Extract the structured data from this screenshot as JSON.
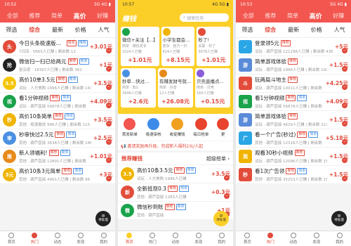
{
  "colors": {
    "accent": "#f2564f",
    "yellow": "#fccf28",
    "price": "#e14a3c"
  },
  "left": {
    "status": {
      "time": "10:52",
      "right": "5G 4G ▮"
    },
    "tabs": [
      "全部",
      "推荐",
      "简单",
      "高价",
      "好赚"
    ],
    "filters": [
      "筛选",
      "综合",
      "最新",
      "价格",
      "人气"
    ],
    "rows": [
      {
        "title": "今日头条极速版填码",
        "tags": [
          "简单",
          "推荐"
        ],
        "meta": "7日回 · 5665人已赚 | 剩余数 12",
        "price": "+3.01元",
        "color": "#e34c3a",
        "icon": "头"
      },
      {
        "title": "微信扫一扫已给两元",
        "tags": [
          "推荐",
          "简单"
        ],
        "meta": "复杂度 · 18397人已赚 | 剩余数 362",
        "price": "+1元",
        "color": "#222",
        "icon": "抢"
      },
      {
        "title": "高价10单3.5元",
        "tags": [
          "推荐",
          "简单"
        ],
        "meta": "试玩 · 人方美购 1996人已赚 | 剩余数 143",
        "price": "+3.5元",
        "color": "#f5c400",
        "icon": "3.5"
      },
      {
        "title": "看1分钟视频",
        "tags": [
          "推荐",
          "简单"
        ],
        "meta": "试玩 · 葫芦直接 56878人已赚 | 剩余数 341",
        "price": "+4.09元",
        "color": "#19a34a",
        "icon": "视"
      },
      {
        "title": "高价10条简单",
        "tags": [
          "推荐",
          "简单"
        ],
        "meta": "其他 · 极速展放 996人已赚 | 剩余数 115",
        "price": "+3.5元",
        "color": "#f0b400",
        "icon": "秒"
      },
      {
        "title": "秒审快过2.5元",
        "tags": [
          "推荐",
          "简单"
        ],
        "meta": "其他 · 葫芦直接 3638人已赚 | 剩余数 186",
        "price": "+2.5元",
        "color": "#4a90e2",
        "icon": "审"
      },
      {
        "title": "新人领福利!",
        "tags": [
          "推荐",
          "简单"
        ],
        "meta": "其他 · 葫芦直接 12891人已赚 | 剩余数 196",
        "price": "+1.01元",
        "color": "#e88a1a",
        "icon": "推"
      },
      {
        "title": "高价10条3元简单",
        "tags": [
          "推荐",
          "简单"
        ],
        "meta": "其他 · 葫芦直接 4991人已赚 | 剩余数 86",
        "price": "+3元",
        "color": "#f0b400",
        "icon": "3元"
      }
    ],
    "nav": [
      "首页",
      "热门",
      "动态",
      "发现",
      "我的"
    ],
    "pending": "待处理"
  },
  "middle": {
    "status": {
      "time": "10:57",
      "right": "4G 5G ▮"
    },
    "logo": "赚钱",
    "search": "搜索任务",
    "cards": [
      {
        "title": "微信+关注【...】",
        "meta": "简单 · 微信发长",
        "count": "1024人已赚",
        "price": "+1.01元"
      },
      {
        "title": "小学生都会...",
        "meta": "复杂 · 官方一日",
        "count": "424人已赚",
        "price": "+8.15元"
      },
      {
        "title": "秒了!",
        "meta": "关联 · 秒了",
        "count": "3976人已赚",
        "price": "+1.01元"
      },
      {
        "title": "秒审...快过...",
        "meta": "简单 · 知1",
        "count": "3946人已赚",
        "price": "+2.6元"
      },
      {
        "title": "有赚发财号就...",
        "meta": "简单 · 抖音",
        "count": "12人已赚",
        "price": "+26.08元"
      },
      {
        "title": "贝壳直播点...",
        "meta": "简单 · 贝壳",
        "count": "165人已赚",
        "price": "+0.15元"
      }
    ],
    "icons": [
      "首发新单",
      "极速审核",
      "收徒赚钱",
      "每日抢单",
      "更"
    ],
    "notice": "📢 邀请奖励再升级，完成新人福利2元/人起",
    "rec": {
      "title": "推荐赚钱",
      "link": "超级榜单 ›"
    },
    "rows": [
      {
        "title": "高价10条3.5元",
        "tags": [
          "推荐",
          "简单"
        ],
        "meta": "试玩 · 人方美购 1996人已赚",
        "price": "+3.5元",
        "color": "#f0b400",
        "icon": "3.5"
      },
      {
        "title": "全新抵现0.3",
        "tags": [
          "推荐",
          "简单"
        ],
        "meta": "其他 · 葫芦直接 1283人已赚",
        "price": "+0.3元",
        "color": "#e34c3a",
        "icon": "新"
      },
      {
        "title": "微信秒到账",
        "tags": [
          "推荐",
          "简单"
        ],
        "meta": "其他 · 葫芦直接",
        "price": "+1元",
        "color": "#19a34a",
        "icon": "微"
      }
    ],
    "nav": [
      "首页",
      "热门",
      "动态",
      "发现",
      "我的"
    ]
  },
  "right": {
    "status": {
      "time": "10:53",
      "right": "5G 4G ▮"
    },
    "tabs": [
      "全部",
      "推荐",
      "简单",
      "高价",
      "好赚"
    ],
    "filters": [
      "筛选",
      "综合",
      "最新",
      "价格",
      "人气"
    ],
    "rows": [
      {
        "title": "登录领5元",
        "tags": [
          "推荐"
        ],
        "meta": "试玩 · 葫芦直接 121298人已赚 | 剩余数 436",
        "price": "+5元",
        "color": "#2aa6e6",
        "icon": "✓"
      },
      {
        "title": "简单游戏体验",
        "tags": [
          "推荐"
        ],
        "meta": "试玩 · 葫芦直接 1996人已赚 | 剩余数 192",
        "price": "+1.5元",
        "color": "#5a8bd8",
        "icon": "游"
      },
      {
        "title": "玩两局斗地主",
        "tags": [
          "推荐"
        ],
        "meta": "试玩 · 葫芦直接 10011人已赚 | 剩余数 186",
        "price": "+4.25元",
        "color": "#e34c3a",
        "icon": "斗"
      },
      {
        "title": "看1分钟视频",
        "tags": [
          "推荐",
          "简单"
        ],
        "meta": "试玩 · 葫芦直接 56878人已赚 | 剩余数 341",
        "price": "+4.09元",
        "color": "#19a34a",
        "icon": "视"
      },
      {
        "title": "简单游戏体验",
        "tags": [
          "推荐"
        ],
        "meta": "试玩 · 葫芦直接 4629人已赚 | 剩余数 211",
        "price": "+1.5元",
        "color": "#5a8bd8",
        "icon": "游"
      },
      {
        "title": "看一个广告(秒过)",
        "tags": [
          "推荐",
          "简单"
        ],
        "meta": "其他 · 葫芦直接 12318人已赚 | 剩余数 59",
        "price": "+5.18元",
        "color": "#2aa6e6",
        "icon": "广"
      },
      {
        "title": "观看30秒小视频",
        "tags": [
          "推荐"
        ],
        "meta": "试玩 · 葫芦直接 12096人已赚 | 剩余数 151",
        "price": "+1.5元",
        "color": "#f0b400",
        "icon": "观"
      },
      {
        "title": "看1次广告领",
        "tags": [
          "推荐",
          "简单"
        ],
        "meta": "其他 · 葫芦直接 35253人已赚 | 剩余数 156",
        "price": "+1.5元",
        "color": "#e34c3a",
        "icon": "秒"
      }
    ],
    "nav": [
      "首页",
      "热门",
      "动态",
      "发现",
      "我的"
    ],
    "pending": "待处理"
  }
}
